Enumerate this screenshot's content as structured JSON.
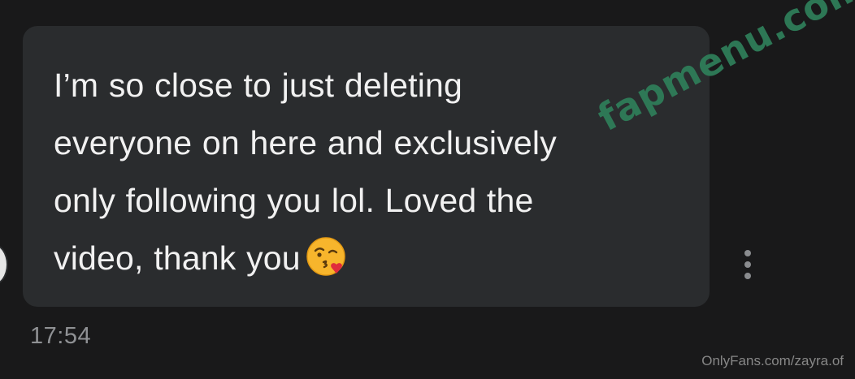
{
  "message": {
    "text": "I’m so close to just deleting\neveryone on here and exclusively\nonly following you lol. Loved the\nvideo, thank you",
    "emoji": "face-blowing-a-kiss",
    "timestamp": "17:54"
  },
  "actions": {
    "more_icon": "vertical-ellipsis-icon"
  },
  "watermarks": {
    "diagonal": "fapmenu.com",
    "bottom": "OnlyFans.com/zayra.of"
  },
  "colors": {
    "background": "#19191a",
    "bubble": "#2a2c2e",
    "message_text": "#f1f1f1",
    "timestamp": "#8f9194",
    "watermark_diagonal": "#2f7f5a"
  }
}
